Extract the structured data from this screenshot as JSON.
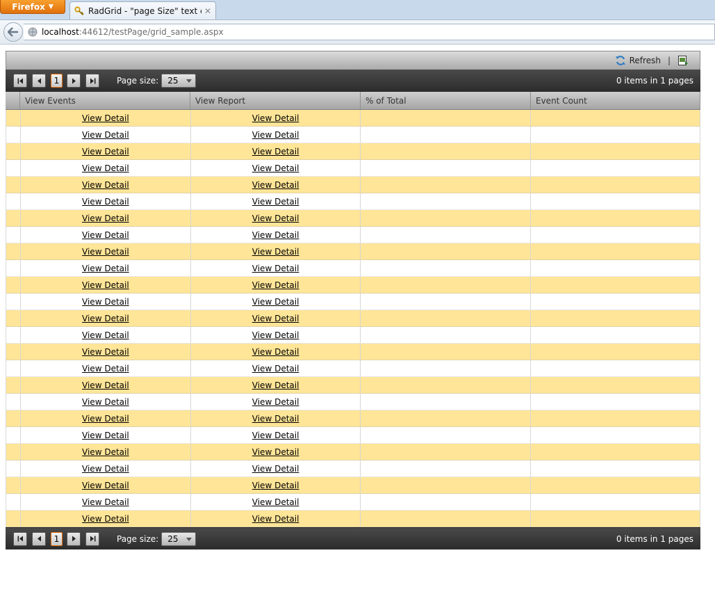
{
  "browser": {
    "menu_label": "Firefox",
    "tab_title": "RadGrid - \"page Size\" text colo...",
    "url_host": "localhost",
    "url_rest": ":44612/testPage/grid_sample.aspx"
  },
  "command_bar": {
    "refresh_label": "Refresh",
    "separator": "|"
  },
  "pager": {
    "current_page": "1",
    "page_size_label": "Page size:",
    "page_size_value": "25",
    "info": "0 items in 1 pages"
  },
  "columns": [
    "View Events",
    "View Report",
    "% of Total",
    "Event Count"
  ],
  "rows": [
    {
      "events": "View Detail",
      "report": "View Detail",
      "pct": "",
      "count": ""
    },
    {
      "events": "View Detail",
      "report": "View Detail",
      "pct": "",
      "count": ""
    },
    {
      "events": "View Detail",
      "report": "View Detail",
      "pct": "",
      "count": ""
    },
    {
      "events": "View Detail",
      "report": "View Detail",
      "pct": "",
      "count": ""
    },
    {
      "events": "View Detail",
      "report": "View Detail",
      "pct": "",
      "count": ""
    },
    {
      "events": "View Detail",
      "report": "View Detail",
      "pct": "",
      "count": ""
    },
    {
      "events": "View Detail",
      "report": "View Detail",
      "pct": "",
      "count": ""
    },
    {
      "events": "View Detail",
      "report": "View Detail",
      "pct": "",
      "count": ""
    },
    {
      "events": "View Detail",
      "report": "View Detail",
      "pct": "",
      "count": ""
    },
    {
      "events": "View Detail",
      "report": "View Detail",
      "pct": "",
      "count": ""
    },
    {
      "events": "View Detail",
      "report": "View Detail",
      "pct": "",
      "count": ""
    },
    {
      "events": "View Detail",
      "report": "View Detail",
      "pct": "",
      "count": ""
    },
    {
      "events": "View Detail",
      "report": "View Detail",
      "pct": "",
      "count": ""
    },
    {
      "events": "View Detail",
      "report": "View Detail",
      "pct": "",
      "count": ""
    },
    {
      "events": "View Detail",
      "report": "View Detail",
      "pct": "",
      "count": ""
    },
    {
      "events": "View Detail",
      "report": "View Detail",
      "pct": "",
      "count": ""
    },
    {
      "events": "View Detail",
      "report": "View Detail",
      "pct": "",
      "count": ""
    },
    {
      "events": "View Detail",
      "report": "View Detail",
      "pct": "",
      "count": ""
    },
    {
      "events": "View Detail",
      "report": "View Detail",
      "pct": "",
      "count": ""
    },
    {
      "events": "View Detail",
      "report": "View Detail",
      "pct": "",
      "count": ""
    },
    {
      "events": "View Detail",
      "report": "View Detail",
      "pct": "",
      "count": ""
    },
    {
      "events": "View Detail",
      "report": "View Detail",
      "pct": "",
      "count": ""
    },
    {
      "events": "View Detail",
      "report": "View Detail",
      "pct": "",
      "count": ""
    },
    {
      "events": "View Detail",
      "report": "View Detail",
      "pct": "",
      "count": ""
    },
    {
      "events": "View Detail",
      "report": "View Detail",
      "pct": "",
      "count": ""
    }
  ],
  "icons": {
    "first_page": "first-page-icon",
    "prev_page": "prev-page-icon",
    "next_page": "next-page-icon",
    "last_page": "last-page-icon",
    "refresh": "refresh-icon",
    "export": "export-csv-icon"
  },
  "colors": {
    "alt_row": "#ffe597",
    "pager_bg": "#3a3a3a",
    "active_page_border": "#e46c0a"
  }
}
